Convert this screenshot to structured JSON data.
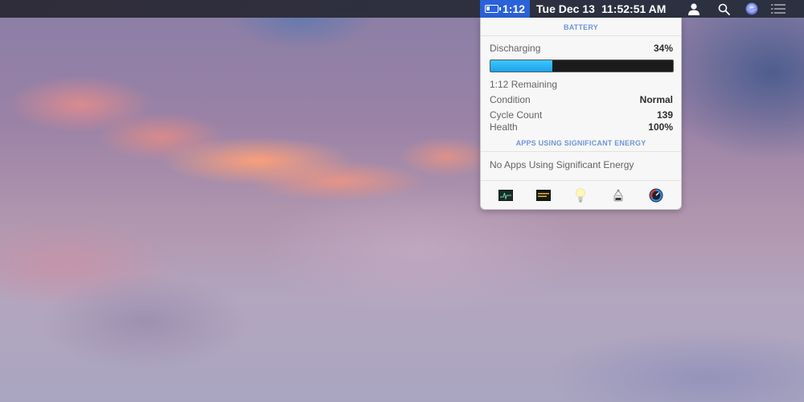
{
  "menubar": {
    "battery_time": "1:12",
    "date": "Tue Dec 13",
    "time": "11:52:51 AM",
    "battery_highlight_color": "#2a62d9",
    "icons": [
      "user-icon",
      "spotlight-search-icon",
      "siri-icon",
      "notification-center-icon"
    ]
  },
  "battery_popover": {
    "section_title": "BATTERY",
    "status_label": "Discharging",
    "percent_label": "34%",
    "charge_fraction": 0.34,
    "bar_color": "#1ba3ea",
    "remaining_label": "1:12 Remaining",
    "details": [
      {
        "label": "Condition",
        "value": "Normal"
      },
      {
        "label": "Cycle Count",
        "value": "139"
      },
      {
        "label": "Health",
        "value": "100%"
      }
    ],
    "apps_section_title": "APPS USING SIGNIFICANT ENERGY",
    "apps_message": "No Apps Using Significant Energy",
    "toolbar_apps": [
      {
        "name": "activity-monitor",
        "icon": "activity-monitor-icon"
      },
      {
        "name": "console-warning",
        "icon": "console-icon"
      },
      {
        "name": "lightbulb",
        "icon": "lightbulb-icon"
      },
      {
        "name": "system-information",
        "icon": "system-information-icon"
      },
      {
        "name": "speedometer",
        "icon": "speedometer-icon"
      }
    ]
  }
}
